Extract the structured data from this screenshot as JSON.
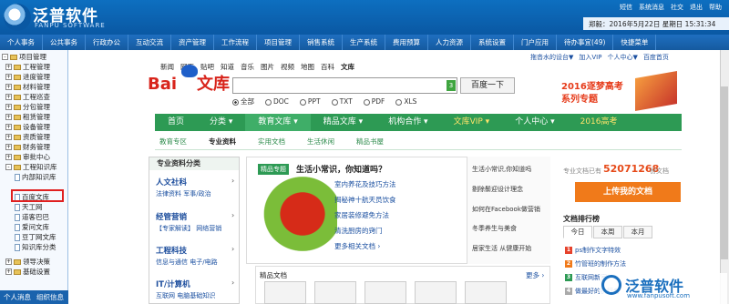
{
  "header": {
    "title": "泛普软件",
    "subtitle": "FANPU SOFTWARE",
    "tools": [
      "短信",
      "系统消息",
      "社交",
      "退出",
      "帮助"
    ],
    "clock": "郑毅：2016年5月22日 星期日 15:31:34"
  },
  "nav": [
    "个人事务",
    "公共事务",
    "行政办公",
    "互动交流",
    "资产管理",
    "工作流程",
    "项目管理",
    "销售系统",
    "生产系统",
    "费用预算",
    "人力资源",
    "系统设置",
    "门户应用",
    "待办事宜(49)",
    "快捷菜单"
  ],
  "sidebar": {
    "root": "项目管理",
    "items": [
      "工程管理",
      "进度管理",
      "材料管理",
      "工程巡查",
      "分包管理",
      "租赁管理",
      "设备管理",
      "资质管理",
      "财务管理",
      "审批中心",
      "工程知识库"
    ],
    "kb_items": [
      "内部知识库",
      "百度文库",
      "天工网",
      "道客巴巴",
      "爱问文库",
      "豆丁网文库",
      "知识库分类"
    ],
    "after": [
      "领导决策",
      "基础设置"
    ],
    "footer": [
      "个人消息",
      "组织信息"
    ]
  },
  "baidu": {
    "tabs": [
      "新闻",
      "网页",
      "贴吧",
      "知道",
      "音乐",
      "图片",
      "视频",
      "地图",
      "百科",
      "文库"
    ],
    "logo_bai": "Bai",
    "logo_du": "du",
    "logo_wk": "文库",
    "search_btn": "百度一下",
    "search_num": "3",
    "filters": [
      "全部",
      "DOC",
      "PPT",
      "TXT",
      "PDF",
      "XLS"
    ],
    "toplinks": [
      "拖沓水的设台▼",
      "加入VIP",
      "个人中心▼",
      "百度首页"
    ],
    "promo": [
      "2016逐梦高考",
      "系列专题"
    ],
    "menu": [
      "首页",
      "分类 ▾",
      "教育文库 ▾",
      "精品文库 ▾",
      "机构合作 ▾",
      "文库VIP ▾",
      "个人中心 ▾",
      "2016高考"
    ],
    "subnav": [
      "教育专区",
      "专业资料",
      "实用文档",
      "生活休闲",
      "精品书屋"
    ],
    "cat_header": "专业资料分类",
    "categories": [
      {
        "title": "人文社科",
        "sub": "法律资料  军事/政治"
      },
      {
        "title": "经管营销",
        "sub": "【专家解读】 网络营销"
      },
      {
        "title": "工程科技",
        "sub": "信息与通信  电子/电路"
      },
      {
        "title": "IT/计算机",
        "sub": "互联网  电脑基础知识"
      }
    ],
    "feature_tag": "精品专题",
    "feature_title": "生活小常识，你知道吗？",
    "feature_links": [
      "室内养花及技巧方法",
      "揭秘神十航天员饮食",
      "家居装修避免方法",
      "清洗厨房的窍门"
    ],
    "feature_more": "更多相关文档 ›",
    "right_list": [
      "生活小常识,你知道吗",
      "剔除鬃迎设计理念",
      "如何在Facebook做营销",
      "冬季养生与美食",
      "居家生活 从健康开始"
    ],
    "rec_title": "精品文档",
    "rec_more": "更多 ›",
    "share_pre": "专业文档已有",
    "share_count": "52071268",
    "share_post": "份文档",
    "upload": "上传我的文档",
    "rank_title": "文档排行榜",
    "rank_tabs": [
      "今日",
      "本周",
      "本月"
    ],
    "ranks": [
      "ps制作文字特效",
      "竹管班的制作方法",
      "互联网新室",
      "做最好的执行者"
    ]
  },
  "watermark": {
    "name": "泛普软件",
    "url": "www.fanpusoft.com"
  },
  "colors": {
    "header": "#0a58a3",
    "green": "#2d9a54",
    "orange": "#f07a1a",
    "highlight": "#e02020"
  }
}
